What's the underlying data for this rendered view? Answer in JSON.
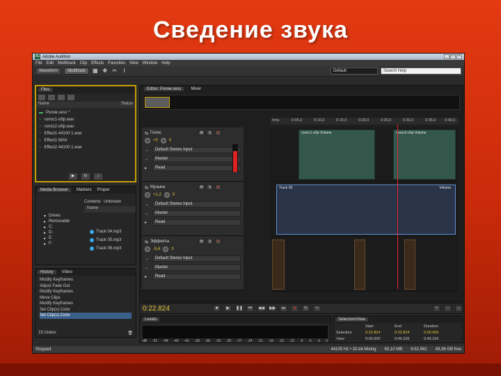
{
  "slide": {
    "title": "Сведение звука"
  },
  "app": {
    "title": "Adobe Audition",
    "menu": [
      "File",
      "Edit",
      "Multitrack",
      "Clip",
      "Effects",
      "Favorites",
      "View",
      "Window",
      "Help"
    ],
    "toolbar": {
      "waveform_label": "Waveform",
      "multitrack_label": "Multitrack",
      "workspace": "Default",
      "search_placeholder": "Search Help"
    }
  },
  "files_panel": {
    "tab": "Files",
    "col_name": "Name",
    "col_status": "Status",
    "items": [
      "Ролик.sesx *",
      "голос1-обр.wav",
      "голос2-обр.wav",
      "Effect1 44100 1.wav",
      "Effect1.WAV",
      "Effect2 44100 1.wav"
    ]
  },
  "media_panel": {
    "tab": "Media Browser",
    "tab2": "Markers",
    "tab3": "Proper",
    "contents_label": "Contents",
    "unknown_label": "Unknown",
    "name_label": "Name",
    "tree": [
      "Drives",
      "Removable",
      "C:",
      "D:",
      "E:",
      "F:"
    ],
    "tracks": [
      "Track 04.mp3",
      "Track 05.mp3",
      "Track 06.mp3"
    ]
  },
  "history_panel": {
    "tab": "History",
    "tab2": "Video",
    "items": [
      "Modify Keyframes",
      "Adjust Fade Out",
      "Modify Keyframes",
      "Move Clips",
      "Modify Keyframes",
      "Set Clip(s) Color",
      "Set Clip(s) Color"
    ],
    "undo": "15 Undos"
  },
  "editor": {
    "tab": "Editor: Ролик.sesx",
    "mixer_tab": "Mixer",
    "ruler": [
      "hms",
      "0:05,0",
      "0:10,0",
      "0:15,0",
      "0:20,0",
      "0:25,0",
      "0:30,0",
      "0:35,0",
      "0:40,0"
    ],
    "tracks": [
      {
        "name": "Голос",
        "volume": "+0",
        "pan": "0",
        "input": "Default Stereo Input",
        "output": "Master",
        "mode": "Read"
      },
      {
        "name": "Музыка",
        "volume": "+1,2",
        "pan": "0",
        "input": "Default Stereo Input",
        "output": "Master",
        "mode": "Read"
      },
      {
        "name": "Эффекты",
        "volume": "-5,6",
        "pan": "0",
        "input": "Default Stereo Input",
        "output": "Master",
        "mode": "Read"
      }
    ],
    "clips": {
      "voice1": "голос1-обр Volume",
      "voice2": "голос2-обр Volume",
      "music": "Track 05",
      "music_vol": "Volume"
    }
  },
  "transport": {
    "timecode": "0:22.824"
  },
  "levels": {
    "tab": "Levels",
    "scale": [
      "dB",
      "-51",
      "-48",
      "-45",
      "-42",
      "-39",
      "-36",
      "-33",
      "-30",
      "-27",
      "-24",
      "-21",
      "-18",
      "-15",
      "-12",
      "-9",
      "-6",
      "-3",
      "0"
    ]
  },
  "selection_view": {
    "tab": "Selection/View",
    "headers": [
      "",
      "Start",
      "End",
      "Duration"
    ],
    "rows": [
      [
        "Selection",
        "0:22.824",
        "0:22.824",
        "0:00.000"
      ],
      [
        "View",
        "0:00.000",
        "0:49.226",
        "0:49.226"
      ]
    ]
  },
  "status": {
    "left": "Stopped",
    "format": "44100 Hz • 32-bit Mixing",
    "mem": "63,10 MB",
    "dur": "6:52.561",
    "free": "49,36 GB free"
  }
}
